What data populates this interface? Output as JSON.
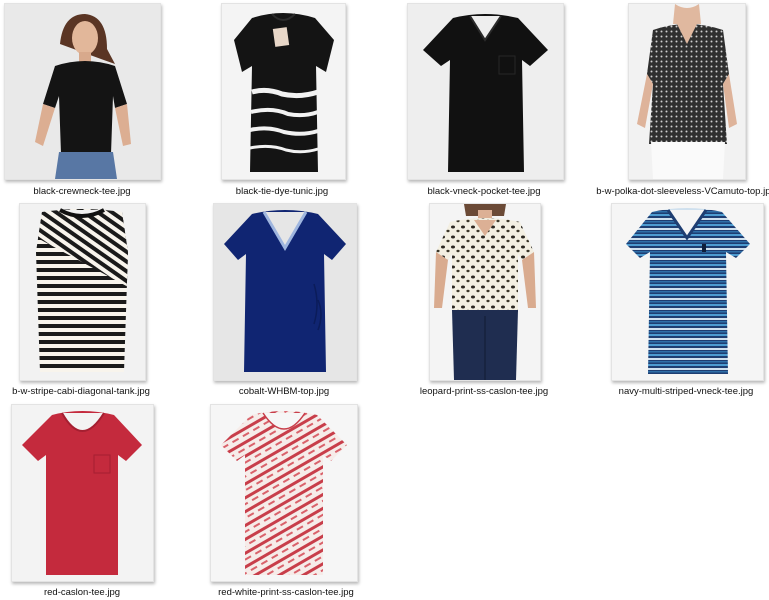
{
  "files": [
    {
      "name": "black-crewneck-tee.jpg",
      "icon": "black-crewneck-tee-thumbnail-icon"
    },
    {
      "name": "black-tie-dye-tunic.jpg",
      "icon": "black-tie-dye-tunic-thumbnail-icon"
    },
    {
      "name": "black-vneck-pocket-tee.jpg",
      "icon": "black-vneck-pocket-tee-thumbnail-icon"
    },
    {
      "name": "b-w-polka-dot-sleeveless-VCamuto-top.jpg",
      "icon": "polka-dot-sleeveless-top-thumbnail-icon"
    },
    {
      "name": "b-w-stripe-cabi-diagonal-tank.jpg",
      "icon": "stripe-diagonal-tank-thumbnail-icon"
    },
    {
      "name": "cobalt-WHBM-top.jpg",
      "icon": "cobalt-top-thumbnail-icon"
    },
    {
      "name": "leopard-print-ss-caslon-tee.jpg",
      "icon": "leopard-print-tee-thumbnail-icon"
    },
    {
      "name": "navy-multi-striped-vneck-tee.jpg",
      "icon": "navy-striped-vneck-tee-thumbnail-icon"
    },
    {
      "name": "red-caslon-tee.jpg",
      "icon": "red-tee-thumbnail-icon"
    },
    {
      "name": "red-white-print-ss-caslon-tee.jpg",
      "icon": "red-white-print-tee-thumbnail-icon"
    }
  ]
}
